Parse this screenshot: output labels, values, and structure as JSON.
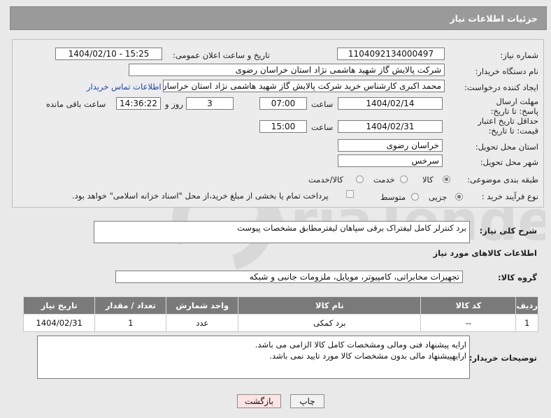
{
  "header": {
    "title": "جزئیات اطلاعات نیاز"
  },
  "form": {
    "need_number_label": "شماره نیاز:",
    "need_number": "1104092134000497",
    "announce_label": "تاریخ و ساعت اعلان عمومی:",
    "announce_value": "1404/02/10 - 15:25",
    "buyer_org_label": "نام دستگاه خریدار:",
    "buyer_org": "شرکت پالایش گاز شهید هاشمی نژاد   استان خراسان رضوی",
    "creator_label": "ایجاد کننده درخواست:",
    "creator": "محمد اکبری کارشناس خرید شرکت پالایش گاز شهید هاشمی نژاد   استان خراسان رضوی",
    "contact_link": "اطلاعات تماس خریدار",
    "deadline_label": "مهلت ارسال پاسخ: تا تاریخ:",
    "deadline_date": "1404/02/14",
    "time_label": "ساعت",
    "deadline_time": "07:00",
    "days_value": "3",
    "days_label": "روز و",
    "remaining_time": "14:36:22",
    "remaining_label": "ساعت باقی مانده",
    "price_validity_label": "حداقل تاریخ اعتبار قیمت: تا تاریخ:",
    "price_validity_date": "1404/02/31",
    "price_validity_time": "15:00",
    "province_label": "استان محل تحویل:",
    "province": "خراسان رضوی",
    "city_label": "شهر محل تحویل:",
    "city": "سرخس",
    "category_label": "طبقه بندی موضوعی:",
    "category_options": [
      "کالا",
      "خدمت",
      "کالا/خدمت"
    ],
    "category_selected": "کالا",
    "process_label": "نوع فرآیند خرید :",
    "process_options": [
      "جزیی",
      "متوسط"
    ],
    "process_selected": "جزیی",
    "payment_note": "پرداخت تمام یا بخشی از مبلغ خرید،از محل \"اسناد خزانه اسلامی\" خواهد بود."
  },
  "description": {
    "label": "شرح کلی نیاز:",
    "value": "برد کنترلر کامل لیفتراک برقی سپاهان لیفترمطابق مشخصات پیوست"
  },
  "goods": {
    "section_title": "اطلاعات کالاهای مورد نیاز",
    "group_label": "گروه کالا:",
    "group_value": "تجهیزات مخابراتی، کامپیوتر، موبایل، ملزومات جانبی و شبکه",
    "columns": [
      "ردیف",
      "کد کالا",
      "نام کالا",
      "واحد شمارش",
      "تعداد / مقدار",
      "تاریخ نیاز"
    ],
    "rows": [
      [
        "1",
        "--",
        "برد کمکی",
        "عدد",
        "1",
        "1404/02/31"
      ]
    ]
  },
  "buyer_notes": {
    "label": "توضیحات خریدار:",
    "line1": "ارایه پیشنهاد فنی ومالی ومشخصات کامل کالا الزامی می باشد.",
    "line2": "ارایهپیشنهاد مالی بدون مشخصات کالا مورد تایید نمی باشد."
  },
  "buttons": {
    "print": "چاپ",
    "back": "بازگشت"
  },
  "watermark": {
    "text": "AriaTender.neT"
  },
  "colors": {
    "header": "#9a9a9a",
    "table_header": "#7a7a7a",
    "link": "#1a44b8",
    "back_button": "#fde3e3"
  }
}
